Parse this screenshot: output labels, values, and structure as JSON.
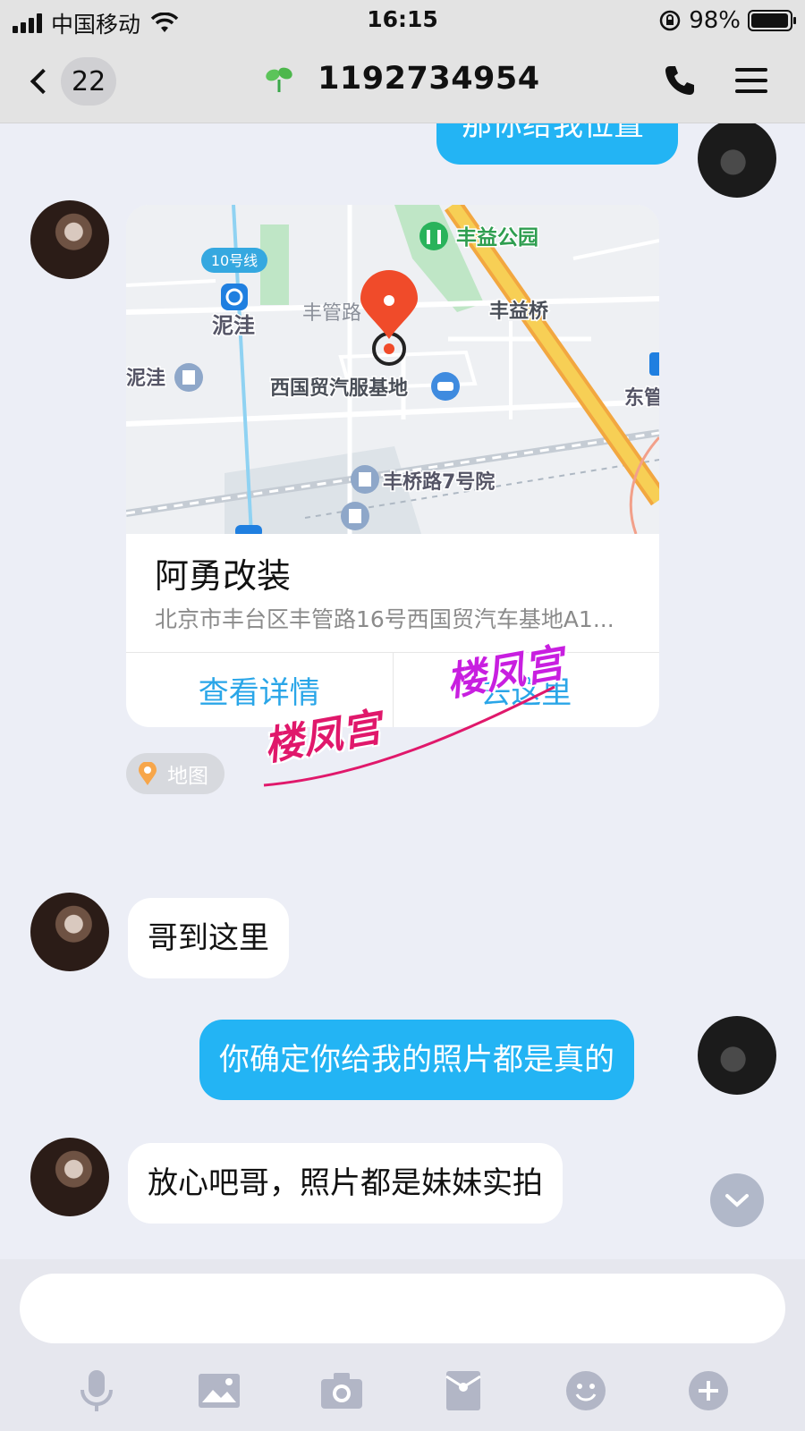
{
  "status_bar": {
    "carrier": "中国移动",
    "time": "16:15",
    "battery": "98%",
    "battery_level": 0.98
  },
  "nav": {
    "unread_count": "22",
    "title": "1192734954"
  },
  "messages": {
    "m1_text": "那你给我位置",
    "m3_text": "哥到这里",
    "m4_text": "你确定你给我的照片都是真的",
    "m5_text": "放心吧哥，照片都是妹妹实拍"
  },
  "location_card": {
    "map_labels": {
      "park": "丰益公园",
      "bridge": "丰益桥",
      "line": "10号线",
      "station": "泥洼",
      "station2": "泥洼",
      "road": "丰管路",
      "base": "西国贸汽服基地",
      "east": "东管",
      "compound": "丰桥路7号院"
    },
    "name": "阿勇改装",
    "address": "北京市丰台区丰管路16号西国贸汽车基地A1...",
    "details_label": "查看详情",
    "go_label": "去这里",
    "tag_label": "地图"
  },
  "watermark": {
    "text_1": "楼凤宫",
    "text_2": "楼凤宫"
  },
  "composer": {
    "placeholder": ""
  },
  "toolbar_icons": [
    "microphone-icon",
    "image-icon",
    "camera-icon",
    "red-packet-icon",
    "emoji-icon",
    "plus-icon"
  ],
  "colors": {
    "outgoing_bubble": "#23b4f4",
    "incoming_bubble": "#ffffff",
    "link_blue": "#2aa6e8",
    "map_pin": "#f04b2a",
    "map_road_yellow": "#f3b93a",
    "watermark": "#e0186b"
  }
}
